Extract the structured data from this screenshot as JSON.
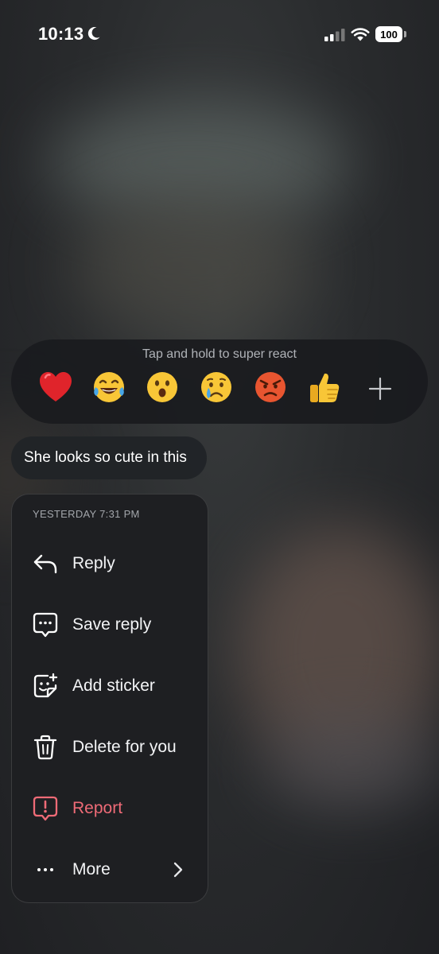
{
  "status_bar": {
    "time": "10:13",
    "battery": "100",
    "icons": [
      "moon-icon",
      "signal-icon",
      "wifi-icon",
      "battery-icon"
    ]
  },
  "reactions": {
    "hint": "Tap and hold to super react",
    "emojis": [
      {
        "name": "heart",
        "char": "❤️"
      },
      {
        "name": "tears-of-joy",
        "char": "😂"
      },
      {
        "name": "surprised",
        "char": "😮"
      },
      {
        "name": "crying",
        "char": "😢"
      },
      {
        "name": "angry",
        "char": "😡"
      },
      {
        "name": "thumbs-up",
        "char": "👍"
      }
    ],
    "more_icon": "plus-icon"
  },
  "message": {
    "text": "She looks so cute in this"
  },
  "menu": {
    "timestamp": "YESTERDAY 7:31 PM",
    "items": [
      {
        "label": "Reply",
        "icon": "reply-icon"
      },
      {
        "label": "Save reply",
        "icon": "save-reply-icon"
      },
      {
        "label": "Add sticker",
        "icon": "add-sticker-icon"
      },
      {
        "label": "Delete for you",
        "icon": "trash-icon"
      },
      {
        "label": "Report",
        "icon": "report-icon",
        "color": "#ef6b77"
      },
      {
        "label": "More",
        "icon": "more-icon"
      }
    ]
  },
  "colors": {
    "danger": "#ef6b77",
    "menu_bg": "#1e1f22",
    "hint_text": "#b0b3b8"
  }
}
